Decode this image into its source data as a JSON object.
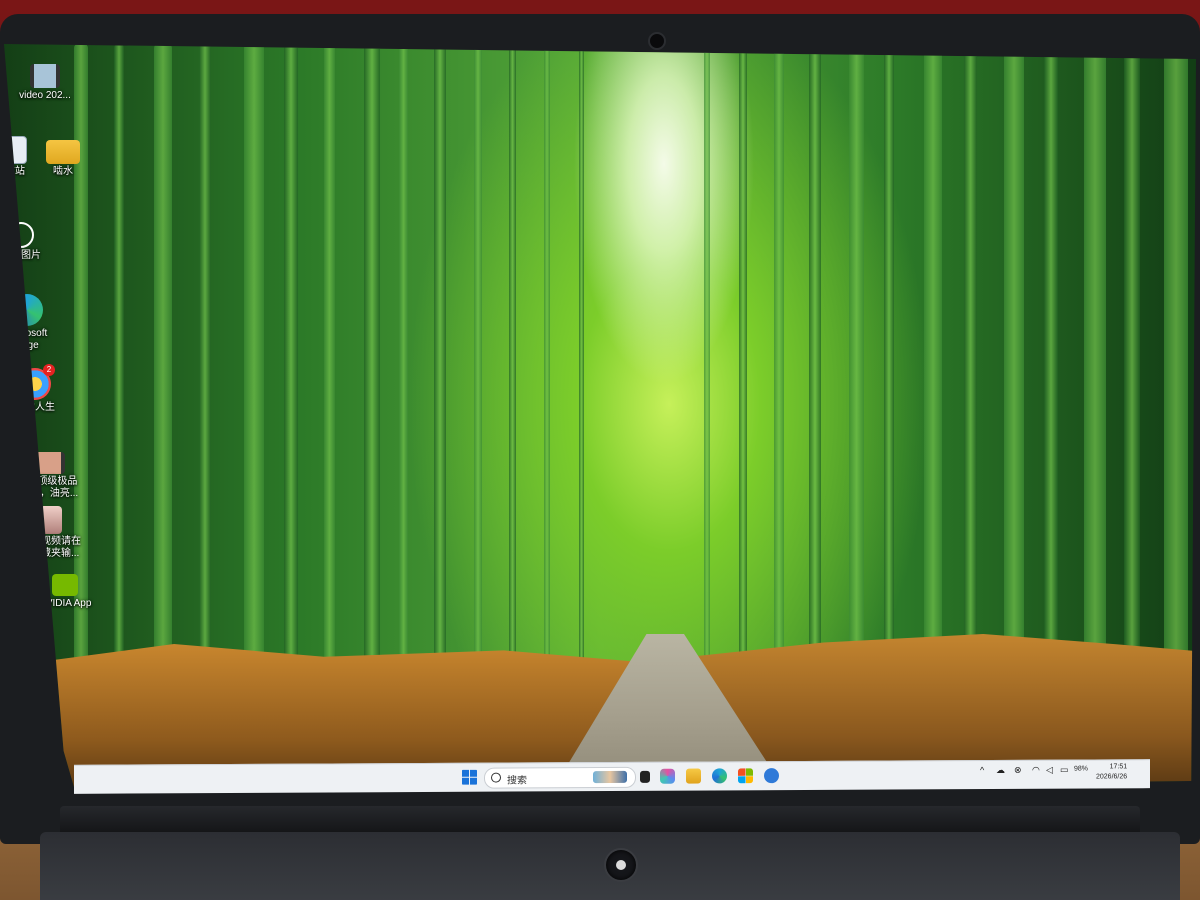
{
  "desktop": {
    "icons": [
      {
        "label": "video 202..."
      },
      {
        "label": "散站"
      },
      {
        "label": "啮水"
      },
      {
        "label": "解此图片"
      },
      {
        "label": "Microsoft\nEdge"
      },
      {
        "label": "驱动人生",
        "badge": "2"
      },
      {
        "label": "P站顶级极品\n身材，油亮..."
      },
      {
        "label": "更多视频请在\ntg收藏夹输..."
      },
      {
        "label": "NVIDIA App"
      }
    ]
  },
  "taskbar": {
    "search_placeholder": "搜索",
    "clock_time": "17:51",
    "clock_date": "2026/6/26",
    "battery_percent": "98%",
    "colors": {
      "taskbar_bg": "#eef1f4",
      "start_blue": "#1a73d9"
    },
    "pinned_icons": [
      "task-view-icon",
      "copilot-icon",
      "file-explorer-icon",
      "edge-icon",
      "store-icon",
      "app-icon"
    ],
    "tray_icons": [
      "chevron-up-icon",
      "cloud-icon",
      "security-icon",
      "wifi-icon",
      "volume-icon",
      "battery-icon"
    ]
  }
}
